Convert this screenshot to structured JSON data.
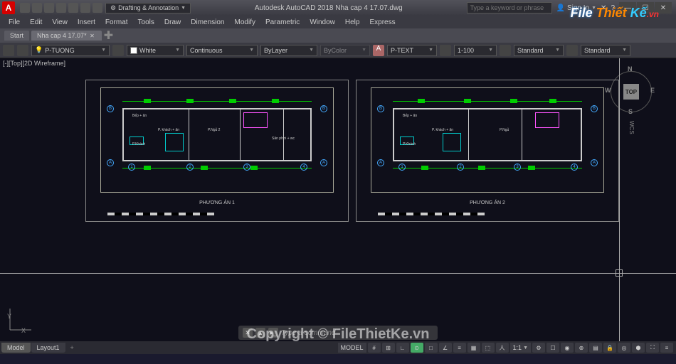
{
  "app_icon_letter": "A",
  "workspace": "Drafting & Annotation",
  "title": "Autodesk AutoCAD 2018   Nha cap 4 17.07.dwg",
  "search_placeholder": "Type a keyword or phrase",
  "signin_label": "Sign In",
  "menu": [
    "File",
    "Edit",
    "View",
    "Insert",
    "Format",
    "Tools",
    "Draw",
    "Dimension",
    "Modify",
    "Parametric",
    "Window",
    "Help",
    "Express"
  ],
  "file_tabs": {
    "start": "Start",
    "current": "Nha cap 4 17.07*"
  },
  "properties": {
    "layer": "P-TUONG",
    "color": "White",
    "linetype": "Continuous",
    "lineweight": "ByLayer",
    "plotstyle": "ByColor",
    "textstyle": "P-TEXT",
    "dimscale": "1-100",
    "dimstyle": "Standard",
    "tablestyle": "Standard"
  },
  "viewport_label": "[-][Top][2D Wireframe]",
  "viewcube": {
    "face": "TOP",
    "n": "N",
    "s": "S",
    "e": "E",
    "w": "W",
    "wcs": "WCS"
  },
  "plans": {
    "left_title": "PHƯƠNG ÁN 1",
    "right_title": "PHƯƠNG ÁN 2",
    "grids_h": [
      "A",
      "B"
    ],
    "grids_v": [
      "1",
      "2",
      "3",
      "4"
    ],
    "rooms_left": [
      "Bếp + ăn",
      "P. khách + ăn",
      "P.Ngủ 2",
      "Sân phơi + wc",
      "P.Khách"
    ],
    "rooms_right": [
      "Bếp + ăn",
      "P. khách + ăn",
      "P.Ngủ",
      "P.Khách"
    ]
  },
  "ucs": {
    "x": "X",
    "y": "Y"
  },
  "command_prompt": "Type a command",
  "layout_tabs": {
    "model": "Model",
    "layout1": "Layout1",
    "add": "+"
  },
  "status": {
    "model_btn": "MODEL",
    "grid": "#",
    "snap": "⊞",
    "ortho": "∟",
    "polar": "⊙",
    "osnap": "□",
    "otrack": "∠",
    "scale": "1:1",
    "gear": "⚙",
    "anno": "人",
    "iso": "▦",
    "full": "⛶"
  },
  "watermark": {
    "logo_parts": [
      "File",
      " Thiết ",
      "Kế",
      ".vn"
    ],
    "copyright": "Copyright © FileThietKe.vn"
  }
}
